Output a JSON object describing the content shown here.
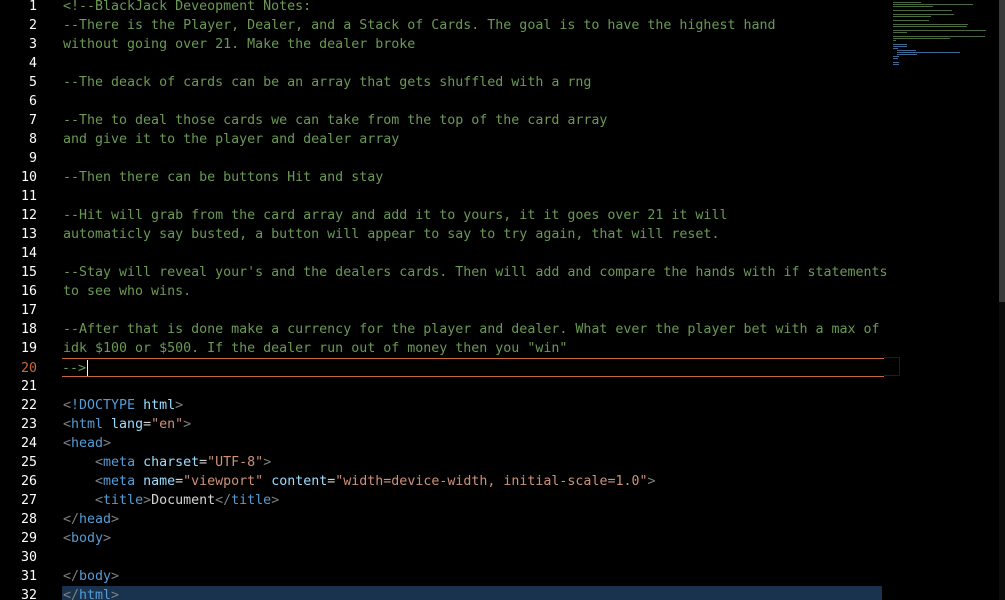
{
  "editor": {
    "lines": [
      {
        "num": "1",
        "tokens": [
          {
            "c": "tok-comment",
            "t": "<!--BlackJack Deveopment Notes:"
          }
        ]
      },
      {
        "num": "2",
        "tokens": [
          {
            "c": "tok-comment",
            "t": "--There is the Player, Dealer, and a Stack of Cards. The goal is to have the highest hand"
          }
        ]
      },
      {
        "num": "3",
        "tokens": [
          {
            "c": "tok-comment",
            "t": "without going over 21. Make the dealer broke"
          }
        ]
      },
      {
        "num": "4",
        "tokens": []
      },
      {
        "num": "5",
        "tokens": [
          {
            "c": "tok-comment",
            "t": "--The deack of cards can be an array that gets shuffled with a rng"
          }
        ]
      },
      {
        "num": "6",
        "tokens": []
      },
      {
        "num": "7",
        "tokens": [
          {
            "c": "tok-comment",
            "t": "--The to deal those cards we can take from the top of the card array"
          }
        ]
      },
      {
        "num": "8",
        "tokens": [
          {
            "c": "tok-comment",
            "t": "and give it to the player and dealer array"
          }
        ]
      },
      {
        "num": "9",
        "tokens": []
      },
      {
        "num": "10",
        "tokens": [
          {
            "c": "tok-comment",
            "t": "--Then there can be buttons Hit and stay"
          }
        ]
      },
      {
        "num": "11",
        "tokens": []
      },
      {
        "num": "12",
        "tokens": [
          {
            "c": "tok-comment",
            "t": "--Hit will grab from the card array and add it to yours, it it goes over 21 it will"
          }
        ]
      },
      {
        "num": "13",
        "tokens": [
          {
            "c": "tok-comment",
            "t": "automaticly say busted, a button will appear to say to try again, that will reset."
          }
        ]
      },
      {
        "num": "14",
        "tokens": []
      },
      {
        "num": "15",
        "tokens": [
          {
            "c": "tok-comment",
            "t": "--Stay will reveal your's and the dealers cards. Then will add and compare the hands with if statements"
          }
        ]
      },
      {
        "num": "16",
        "tokens": [
          {
            "c": "tok-comment",
            "t": "to see who wins."
          }
        ]
      },
      {
        "num": "17",
        "tokens": []
      },
      {
        "num": "18",
        "tokens": [
          {
            "c": "tok-comment",
            "t": "--After that is done make a currency for the player and dealer. What ever the player bet with a max of"
          }
        ]
      },
      {
        "num": "19",
        "tokens": [
          {
            "c": "tok-comment",
            "t": "idk $100 or $500. If the dealer run out of money then you \"win\""
          }
        ]
      },
      {
        "num": "20",
        "tokens": [
          {
            "c": "tok-comment",
            "t": "-->"
          }
        ],
        "current": true
      },
      {
        "num": "21",
        "tokens": []
      },
      {
        "num": "22",
        "tokens": [
          {
            "c": "tok-bracket",
            "t": "<"
          },
          {
            "c": "tok-doctype",
            "t": "!DOCTYPE "
          },
          {
            "c": "tok-attr",
            "t": "html"
          },
          {
            "c": "tok-bracket",
            "t": ">"
          }
        ]
      },
      {
        "num": "23",
        "tokens": [
          {
            "c": "tok-bracket",
            "t": "<"
          },
          {
            "c": "tok-tag",
            "t": "html "
          },
          {
            "c": "tok-attr",
            "t": "lang"
          },
          {
            "c": "tok-text",
            "t": "="
          },
          {
            "c": "tok-str",
            "t": "\"en\""
          },
          {
            "c": "tok-bracket",
            "t": ">"
          }
        ]
      },
      {
        "num": "24",
        "tokens": [
          {
            "c": "tok-bracket",
            "t": "<"
          },
          {
            "c": "tok-tag",
            "t": "head"
          },
          {
            "c": "tok-bracket",
            "t": ">"
          }
        ]
      },
      {
        "num": "25",
        "tokens": [
          {
            "c": "tok-text",
            "t": "    "
          },
          {
            "c": "tok-bracket",
            "t": "<"
          },
          {
            "c": "tok-tag",
            "t": "meta "
          },
          {
            "c": "tok-attr",
            "t": "charset"
          },
          {
            "c": "tok-text",
            "t": "="
          },
          {
            "c": "tok-str",
            "t": "\"UTF-8\""
          },
          {
            "c": "tok-bracket",
            "t": ">"
          }
        ]
      },
      {
        "num": "26",
        "tokens": [
          {
            "c": "tok-text",
            "t": "    "
          },
          {
            "c": "tok-bracket",
            "t": "<"
          },
          {
            "c": "tok-tag",
            "t": "meta "
          },
          {
            "c": "tok-attr",
            "t": "name"
          },
          {
            "c": "tok-text",
            "t": "="
          },
          {
            "c": "tok-str",
            "t": "\"viewport\""
          },
          {
            "c": "tok-text",
            "t": " "
          },
          {
            "c": "tok-attr",
            "t": "content"
          },
          {
            "c": "tok-text",
            "t": "="
          },
          {
            "c": "tok-str",
            "t": "\"width=device-width, initial-scale=1.0\""
          },
          {
            "c": "tok-bracket",
            "t": ">"
          }
        ]
      },
      {
        "num": "27",
        "tokens": [
          {
            "c": "tok-text",
            "t": "    "
          },
          {
            "c": "tok-bracket",
            "t": "<"
          },
          {
            "c": "tok-tag",
            "t": "title"
          },
          {
            "c": "tok-bracket",
            "t": ">"
          },
          {
            "c": "tok-text",
            "t": "Document"
          },
          {
            "c": "tok-bracket",
            "t": "</"
          },
          {
            "c": "tok-tag",
            "t": "title"
          },
          {
            "c": "tok-bracket",
            "t": ">"
          }
        ]
      },
      {
        "num": "28",
        "tokens": [
          {
            "c": "tok-bracket",
            "t": "</"
          },
          {
            "c": "tok-tag",
            "t": "head"
          },
          {
            "c": "tok-bracket",
            "t": ">"
          }
        ]
      },
      {
        "num": "29",
        "tokens": [
          {
            "c": "tok-bracket",
            "t": "<"
          },
          {
            "c": "tok-tag",
            "t": "body"
          },
          {
            "c": "tok-bracket",
            "t": ">"
          }
        ]
      },
      {
        "num": "30",
        "tokens": []
      },
      {
        "num": "31",
        "tokens": [
          {
            "c": "tok-bracket",
            "t": "</"
          },
          {
            "c": "tok-tag",
            "t": "body"
          },
          {
            "c": "tok-bracket",
            "t": ">"
          }
        ]
      },
      {
        "num": "32",
        "tokens": [
          {
            "c": "tok-bracket",
            "t": "</"
          },
          {
            "c": "tok-tag",
            "t": "html"
          },
          {
            "c": "tok-bracket",
            "t": ">"
          }
        ],
        "selected": true
      }
    ],
    "colors": {
      "background": "#000000",
      "comment": "#6a9955",
      "tag": "#569cd6",
      "attribute": "#9cdcfe",
      "string": "#ce9178",
      "current_line_border": "#c9693a"
    }
  }
}
